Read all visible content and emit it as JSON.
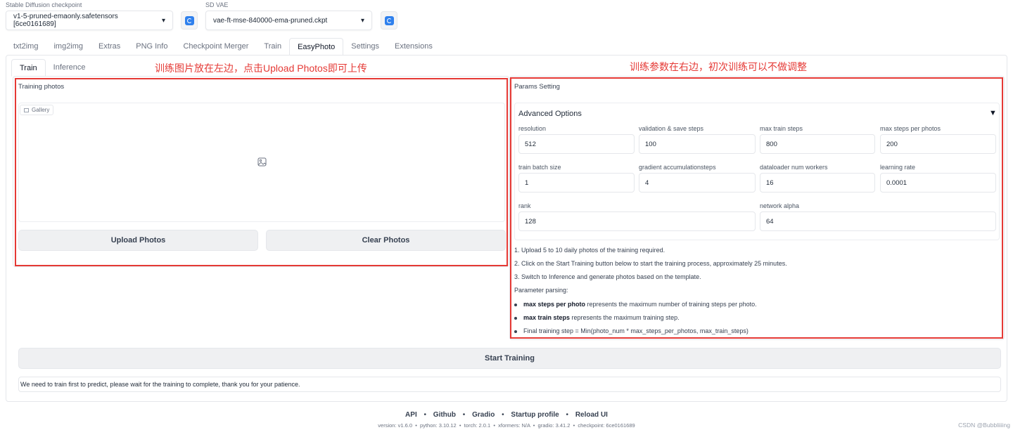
{
  "header": {
    "checkpoint_label": "Stable Diffusion checkpoint",
    "checkpoint_value": "v1-5-pruned-emaonly.safetensors [6ce0161689]",
    "vae_label": "SD VAE",
    "vae_value": "vae-ft-mse-840000-ema-pruned.ckpt",
    "chevron": "▾"
  },
  "main_tabs": [
    "txt2img",
    "img2img",
    "Extras",
    "PNG Info",
    "Checkpoint Merger",
    "Train",
    "EasyPhoto",
    "Settings",
    "Extensions"
  ],
  "sub_tabs": [
    "Train",
    "Inference"
  ],
  "annotations": {
    "left": "训练图片放在左边，点击Upload Photos即可上传",
    "right": "训练参数在右边，初次训练可以不做调整"
  },
  "left_panel": {
    "title": "Training photos",
    "gallery_label": "Gallery",
    "upload_button": "Upload Photos",
    "clear_button": "Clear Photos"
  },
  "right_panel": {
    "title": "Params Setting",
    "accordion_title": "Advanced Options",
    "accordion_toggle": "▼",
    "fields": {
      "resolution": {
        "label": "resolution",
        "value": "512"
      },
      "validation": {
        "label": "validation & save steps",
        "value": "100"
      },
      "max_train_steps": {
        "label": "max train steps",
        "value": "800"
      },
      "max_steps_per_photos": {
        "label": "max steps per photos",
        "value": "200"
      },
      "train_batch_size": {
        "label": "train batch size",
        "value": "1"
      },
      "grad_accum": {
        "label": "gradient accumulationsteps",
        "value": "4"
      },
      "dataloader": {
        "label": "dataloader num workers",
        "value": "16"
      },
      "learning_rate": {
        "label": "learning rate",
        "value": "0.0001"
      },
      "rank": {
        "label": "rank",
        "value": "128"
      },
      "network_alpha": {
        "label": "network alpha",
        "value": "64"
      }
    },
    "notes": [
      "1. Upload 5 to 10 daily photos of the training required.",
      "2. Click on the Start Training button below to start the training process, approximately 25 minutes.",
      "3. Switch to Inference and generate photos based on the template."
    ],
    "parsing_title": "Parameter parsing:",
    "bullets": [
      {
        "bold": "max steps per photo",
        "text": " represents the maximum number of training steps per photo."
      },
      {
        "bold": "max train steps",
        "text": " represents the maximum training step."
      },
      {
        "bold": "",
        "text": "Final training step = Min(photo_num * max_steps_per_photos, max_train_steps)"
      }
    ]
  },
  "start_button": "Start Training",
  "status_text": "We need to train first to predict, please wait for the training to complete, thank you for your patience.",
  "footer": {
    "links": [
      "API",
      "Github",
      "Gradio",
      "Startup profile",
      "Reload UI"
    ],
    "separator": "•",
    "version_line": "version: v1.6.0  •  python: 3.10.12  •  torch: 2.0.1  •  xformers: N/A  •  gradio: 3.41.2  •  checkpoint: 6ce0161689",
    "watermark": "CSDN @Bubbliiiing"
  },
  "colors": {
    "annotation_red": "#e53935",
    "refresh_blue": "#2f80ed"
  }
}
